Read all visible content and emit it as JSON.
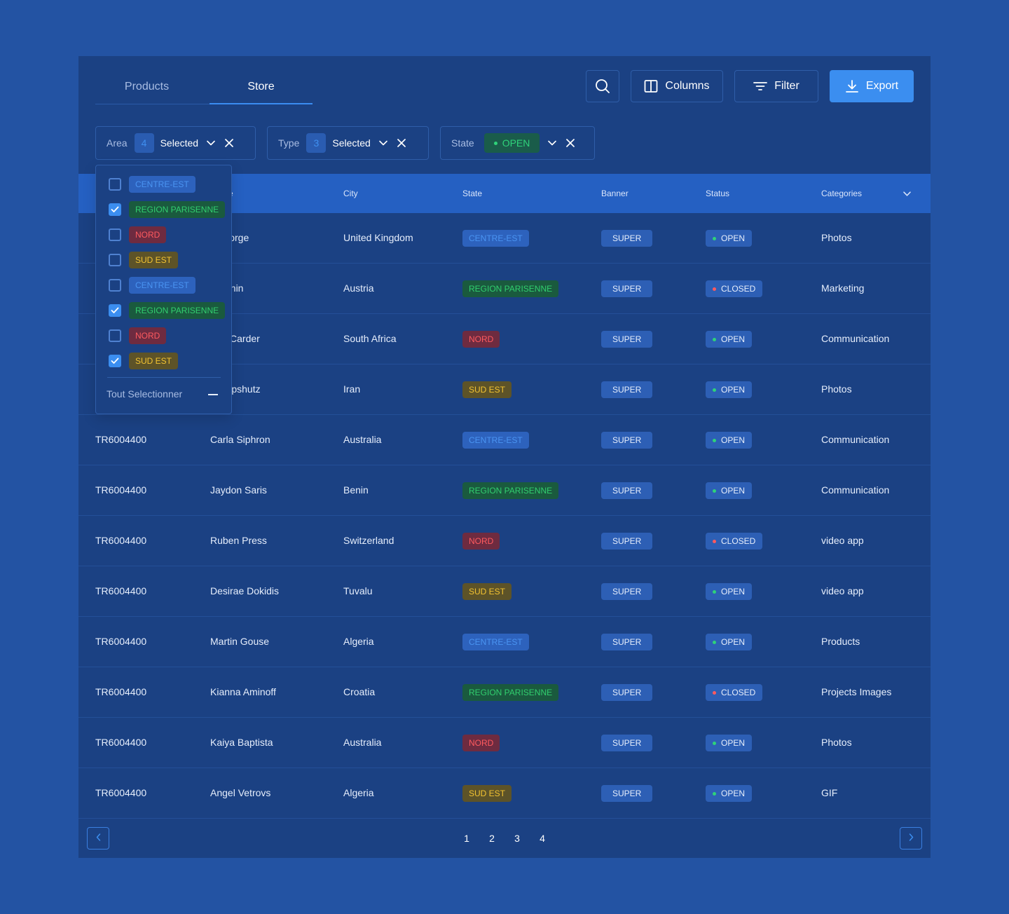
{
  "tabs": [
    {
      "label": "Products"
    },
    {
      "label": "Store"
    }
  ],
  "toolbar": {
    "search_icon": "search-icon",
    "columns_label": "Columns",
    "filter_label": "Filter",
    "export_label": "Export"
  },
  "filters": {
    "area": {
      "label": "Area",
      "count": "4",
      "selected": "Selected"
    },
    "type": {
      "label": "Type",
      "count": "3",
      "selected": "Selected"
    },
    "state": {
      "label": "State",
      "value": "OPEN"
    }
  },
  "table": {
    "headers": {
      "col1": "",
      "col2": "e",
      "city": "City",
      "state": "State",
      "banner": "Banner",
      "status": "Status",
      "categories": "Categories"
    },
    "rows": [
      {
        "id": "",
        "name": "r George",
        "city": "United Kingdom",
        "state": "CENTRE-EST",
        "banner": "SUPER",
        "status": "OPEN",
        "category": "Photos"
      },
      {
        "id": "",
        "name": "y Donin",
        "city": "Austria",
        "state": "REGION PARISENNE",
        "banner": "SUPER",
        "status": "CLOSED",
        "category": "Marketing"
      },
      {
        "id": "",
        "name": "ofer Carder",
        "city": "South Africa",
        "state": "NORD",
        "banner": "SUPER",
        "status": "OPEN",
        "category": "Communication"
      },
      {
        "id": "",
        "name": "on Lipshutz",
        "city": "Iran",
        "state": "SUD EST",
        "banner": "SUPER",
        "status": "OPEN",
        "category": "Photos"
      },
      {
        "id": "TR6004400",
        "name": "Carla Siphron",
        "city": "Australia",
        "state": "CENTRE-EST",
        "banner": "SUPER",
        "status": "OPEN",
        "category": "Communication"
      },
      {
        "id": "TR6004400",
        "name": "Jaydon Saris",
        "city": "Benin",
        "state": "REGION PARISENNE",
        "banner": "SUPER",
        "status": "OPEN",
        "category": "Communication"
      },
      {
        "id": "TR6004400",
        "name": "Ruben Press",
        "city": "Switzerland",
        "state": "NORD",
        "banner": "SUPER",
        "status": "CLOSED",
        "category": "video app"
      },
      {
        "id": "TR6004400",
        "name": "Desirae Dokidis",
        "city": "Tuvalu",
        "state": "SUD EST",
        "banner": "SUPER",
        "status": "OPEN",
        "category": "video app"
      },
      {
        "id": "TR6004400",
        "name": "Martin Gouse",
        "city": "Algeria",
        "state": "CENTRE-EST",
        "banner": "SUPER",
        "status": "OPEN",
        "category": "Products"
      },
      {
        "id": "TR6004400",
        "name": "Kianna Aminoff",
        "city": "Croatia",
        "state": "REGION PARISENNE",
        "banner": "SUPER",
        "status": "CLOSED",
        "category": "Projects Images"
      },
      {
        "id": "TR6004400",
        "name": "Kaiya Baptista",
        "city": "Australia",
        "state": "NORD",
        "banner": "SUPER",
        "status": "OPEN",
        "category": "Photos"
      },
      {
        "id": "TR6004400",
        "name": "Angel Vetrovs",
        "city": "Algeria",
        "state": "SUD EST",
        "banner": "SUPER",
        "status": "OPEN",
        "category": "GIF"
      }
    ]
  },
  "pagination": {
    "pages": [
      "1",
      "2",
      "3",
      "4"
    ]
  },
  "area_dropdown": {
    "options": [
      {
        "label": "CENTRE-EST",
        "checked": false
      },
      {
        "label": "REGION PARISENNE",
        "checked": true
      },
      {
        "label": "NORD",
        "checked": false
      },
      {
        "label": "SUD EST",
        "checked": false
      },
      {
        "label": "CENTRE-EST",
        "checked": false
      },
      {
        "label": "REGION PARISENNE",
        "checked": true
      },
      {
        "label": "NORD",
        "checked": false
      },
      {
        "label": "SUD EST",
        "checked": true
      }
    ],
    "select_all_label": "Tout Selectionner"
  },
  "colors": {
    "background": "#2353a3",
    "panel": "#1b4183",
    "accent": "#3b8ef0",
    "open": "#2fd27a",
    "closed": "#ff5a5f"
  }
}
